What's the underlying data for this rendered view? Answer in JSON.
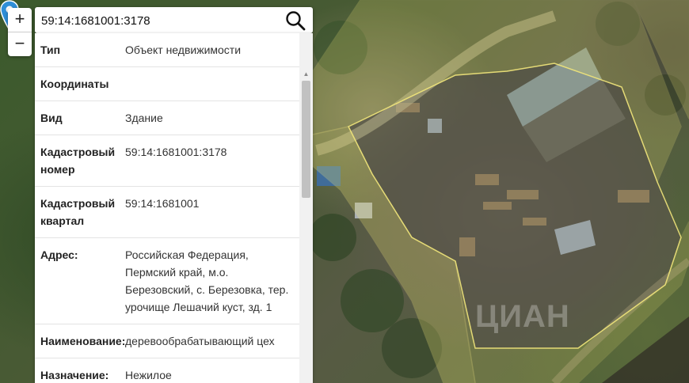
{
  "search": {
    "value": "59:14:1681001:3178"
  },
  "zoom": {
    "in_label": "+",
    "out_label": "−"
  },
  "info": {
    "rows": [
      {
        "key": "Тип",
        "value": "Объект недвижимости"
      },
      {
        "key": "Координаты",
        "value": ""
      },
      {
        "key": "Вид",
        "value": "Здание"
      },
      {
        "key": "Кадастровый номер",
        "value": "59:14:1681001:3178"
      },
      {
        "key": "Кадастровый квартал",
        "value": "59:14:1681001"
      },
      {
        "key": "Адрес:",
        "value": "Российская Федерация, Пермский край, м.о. Березовский, с. Березовка, тер. урочище Лешачий куст, зд. 1"
      },
      {
        "key": "Наименование:",
        "value": "деревообрабатывающий цех"
      },
      {
        "key": "Назначение:",
        "value": "Нежилое"
      }
    ]
  },
  "map": {
    "watermark": "ЦИАН",
    "parcel_color": "#e8e070",
    "marker_color": "#2f8fd8"
  },
  "icons": {
    "search": "search-icon",
    "marker": "map-marker-icon"
  }
}
